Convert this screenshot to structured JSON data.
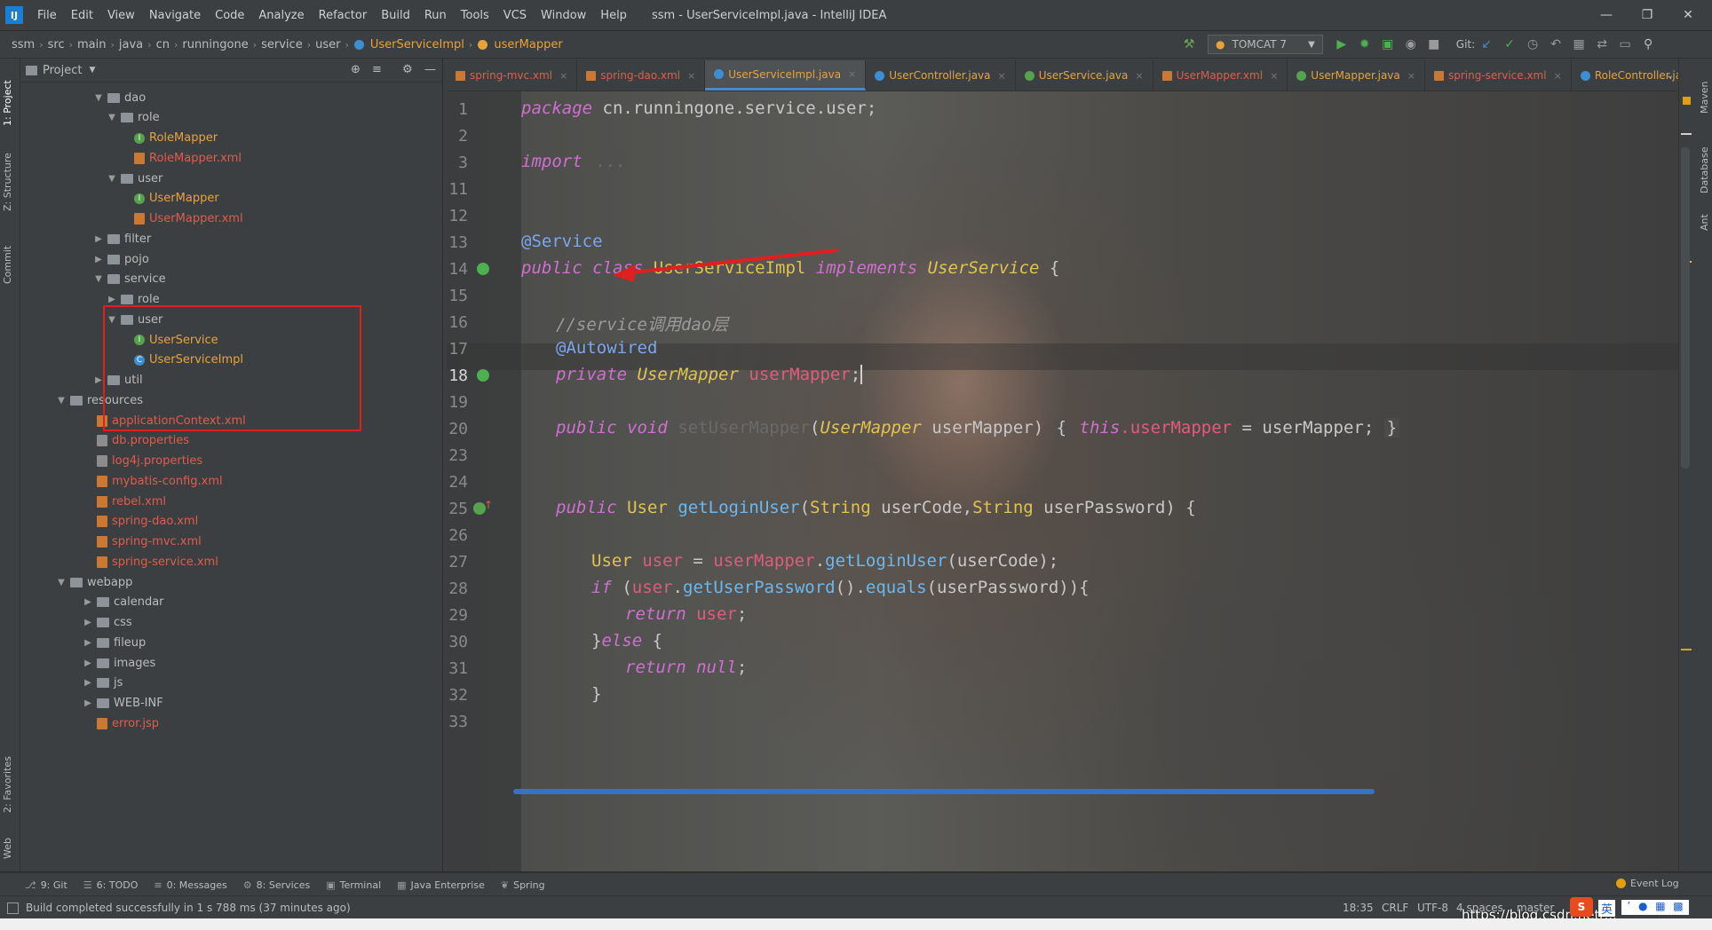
{
  "menu": [
    "File",
    "Edit",
    "View",
    "Navigate",
    "Code",
    "Analyze",
    "Refactor",
    "Build",
    "Run",
    "Tools",
    "VCS",
    "Window",
    "Help"
  ],
  "window_title": "ssm - UserServiceImpl.java - IntelliJ IDEA",
  "breadcrumbs": [
    "ssm",
    "src",
    "main",
    "java",
    "cn",
    "runningone",
    "service",
    "user",
    "UserServiceImpl",
    "userMapper"
  ],
  "run_config": "TOMCAT 7",
  "vcs_label": "Git:",
  "left_tabs": [
    "1: Project",
    "Z: Structure",
    "Commit",
    "2: Favorites",
    "Web"
  ],
  "right_tabs": [
    "Maven",
    "Database",
    "Ant"
  ],
  "project_panel": {
    "title": "Project"
  },
  "tree": [
    {
      "label": "dao",
      "type": "dir",
      "indent": 1,
      "open": true,
      "color": "dir"
    },
    {
      "label": "role",
      "type": "dir",
      "indent": 2,
      "open": true,
      "color": "dir"
    },
    {
      "label": "RoleMapper",
      "type": "interface",
      "indent": 3,
      "color": "red"
    },
    {
      "label": "RoleMapper.xml",
      "type": "xml",
      "indent": 3,
      "color": "red"
    },
    {
      "label": "user",
      "type": "dir",
      "indent": 2,
      "open": true,
      "color": "dir"
    },
    {
      "label": "UserMapper",
      "type": "interface",
      "indent": 3,
      "color": "red"
    },
    {
      "label": "UserMapper.xml",
      "type": "xml",
      "indent": 3,
      "color": "red"
    },
    {
      "label": "filter",
      "type": "dir",
      "indent": 1,
      "open": false,
      "color": "dir"
    },
    {
      "label": "pojo",
      "type": "dir",
      "indent": 1,
      "open": false,
      "color": "dir"
    },
    {
      "label": "service",
      "type": "dir",
      "indent": 1,
      "open": true,
      "color": "dir"
    },
    {
      "label": "role",
      "type": "dir",
      "indent": 2,
      "open": false,
      "color": "dir"
    },
    {
      "label": "user",
      "type": "dir",
      "indent": 2,
      "open": true,
      "color": "dir"
    },
    {
      "label": "UserService",
      "type": "interface",
      "indent": 3,
      "color": "red"
    },
    {
      "label": "UserServiceImpl",
      "type": "class",
      "indent": 3,
      "color": "red"
    },
    {
      "label": "util",
      "type": "dir",
      "indent": 1,
      "open": false,
      "color": "dir"
    },
    {
      "label": "resources",
      "type": "dir",
      "indent": -1,
      "open": true,
      "color": "dir"
    },
    {
      "label": "applicationContext.xml",
      "type": "xml",
      "indent": 0,
      "color": "red"
    },
    {
      "label": "db.properties",
      "type": "props",
      "indent": 0,
      "color": "red"
    },
    {
      "label": "log4j.properties",
      "type": "props",
      "indent": 0,
      "color": "red"
    },
    {
      "label": "mybatis-config.xml",
      "type": "xml",
      "indent": 0,
      "color": "red"
    },
    {
      "label": "rebel.xml",
      "type": "xml",
      "indent": 0,
      "color": "red"
    },
    {
      "label": "spring-dao.xml",
      "type": "xml",
      "indent": 0,
      "color": "red"
    },
    {
      "label": "spring-mvc.xml",
      "type": "xml",
      "indent": 0,
      "color": "red"
    },
    {
      "label": "spring-service.xml",
      "type": "xml",
      "indent": 0,
      "color": "red"
    },
    {
      "label": "webapp",
      "type": "dir",
      "indent": -1,
      "open": true,
      "color": "dir"
    },
    {
      "label": "calendar",
      "type": "dir",
      "indent": 0,
      "open": false,
      "color": "dir"
    },
    {
      "label": "css",
      "type": "dir",
      "indent": 0,
      "open": false,
      "color": "dir"
    },
    {
      "label": "fileup",
      "type": "dir",
      "indent": 0,
      "open": false,
      "color": "dir"
    },
    {
      "label": "images",
      "type": "dir",
      "indent": 0,
      "open": false,
      "color": "dir"
    },
    {
      "label": "js",
      "type": "dir",
      "indent": 0,
      "open": false,
      "color": "dir"
    },
    {
      "label": "WEB-INF",
      "type": "dir",
      "indent": 0,
      "open": false,
      "color": "dir"
    },
    {
      "label": "error.jsp",
      "type": "xml",
      "indent": 0,
      "color": "red"
    }
  ],
  "tabs": [
    {
      "label": "spring-mvc.xml",
      "kind": "xml"
    },
    {
      "label": "spring-dao.xml",
      "kind": "xml"
    },
    {
      "label": "UserServiceImpl.java",
      "kind": "class",
      "active": true
    },
    {
      "label": "UserController.java",
      "kind": "class"
    },
    {
      "label": "UserService.java",
      "kind": "interface"
    },
    {
      "label": "UserMapper.xml",
      "kind": "xml"
    },
    {
      "label": "UserMapper.java",
      "kind": "interface"
    },
    {
      "label": "spring-service.xml",
      "kind": "xml"
    },
    {
      "label": "RoleController.java",
      "kind": "class"
    }
  ],
  "code": {
    "l1": {
      "n": "1",
      "kw": "package",
      "rest": " cn.runningone.service.user;"
    },
    "l2": {
      "n": "2"
    },
    "l3": {
      "n": "3",
      "kw": "import",
      "fold": "..."
    },
    "l11": {
      "n": "11"
    },
    "l12": {
      "n": "12"
    },
    "l13": {
      "n": "13",
      "ann": "@Service"
    },
    "l14": {
      "n": "14",
      "kw1": "public",
      "kw2": "class",
      "cls": "UserServiceImpl",
      "kw3": "implements",
      "itf": "UserService",
      "rest": " {"
    },
    "l15": {
      "n": "15"
    },
    "l16": {
      "n": "16",
      "cmt": "//service调用dao层"
    },
    "l17": {
      "n": "17",
      "ann": "@Autowired"
    },
    "l18": {
      "n": "18",
      "kw": "private",
      "itf": "UserMapper",
      "fld": "userMapper",
      "rest": ";"
    },
    "l19": {
      "n": "19"
    },
    "l20": {
      "n": "20",
      "kw1": "public",
      "kw2": "void",
      "mth": "setUserMapper",
      "p1": "(",
      "itf": "UserMapper",
      "p2": " userMapper) ",
      "b1": "{",
      "kw3": "this",
      "fld": ".userMapper",
      "p3": " = userMapper; ",
      "b2": "}"
    },
    "l23": {
      "n": "23"
    },
    "l24": {
      "n": "24"
    },
    "l25": {
      "n": "25",
      "kw": "public",
      "cls": "User",
      "mth": "getLoginUser",
      "p1": "(",
      "c1": "String",
      "p2": " userCode,",
      "c2": "String",
      "p3": " userPassword) {"
    },
    "l26": {
      "n": "26"
    },
    "l27": {
      "n": "27",
      "cls": "User",
      "fld1": " user",
      "p1": " = ",
      "fld2": "userMapper",
      "p2": ".",
      "mth": "getLoginUser",
      "p3": "(userCode);"
    },
    "l28": {
      "n": "28",
      "kw": "if",
      "p1": " (",
      "fld1": "user",
      "p2": ".",
      "mth1": "getUserPassword",
      "p3": "().",
      "mth2": "equals",
      "p4": "(userPassword)){"
    },
    "l29": {
      "n": "29",
      "kw": "return",
      "fld": " user",
      "rest": ";"
    },
    "l30": {
      "n": "30",
      "p1": "}",
      "kw": "else",
      "rest": " {"
    },
    "l31": {
      "n": "31",
      "kw": "return",
      "kw2": " null",
      "rest": ";"
    },
    "l32": {
      "n": "32",
      "rest": "}"
    },
    "l33": {
      "n": "33"
    }
  },
  "bottom_tools": [
    {
      "icon": "git-icon",
      "label": "9: Git"
    },
    {
      "icon": "todo-icon",
      "label": "6: TODO"
    },
    {
      "icon": "messages-icon",
      "label": "0: Messages"
    },
    {
      "icon": "services-icon",
      "label": "8: Services"
    },
    {
      "icon": "terminal-icon",
      "label": "Terminal"
    },
    {
      "icon": "javaee-icon",
      "label": "Java Enterprise"
    },
    {
      "icon": "spring-icon",
      "label": "Spring"
    }
  ],
  "event_log": "Event Log",
  "status": {
    "message": "Build completed successfully in 1 s 788 ms (37 minutes ago)",
    "position": "18:35",
    "line_sep": "CRLF",
    "encoding": "UTF-8",
    "indent": "4 spaces",
    "branch": "master",
    "watermark": "https://blog.csdn.net/...",
    "ime": "英"
  },
  "colors": {
    "accent": "#4a88c7",
    "arrow": "#e02020",
    "highlight_box": "#e02020"
  }
}
